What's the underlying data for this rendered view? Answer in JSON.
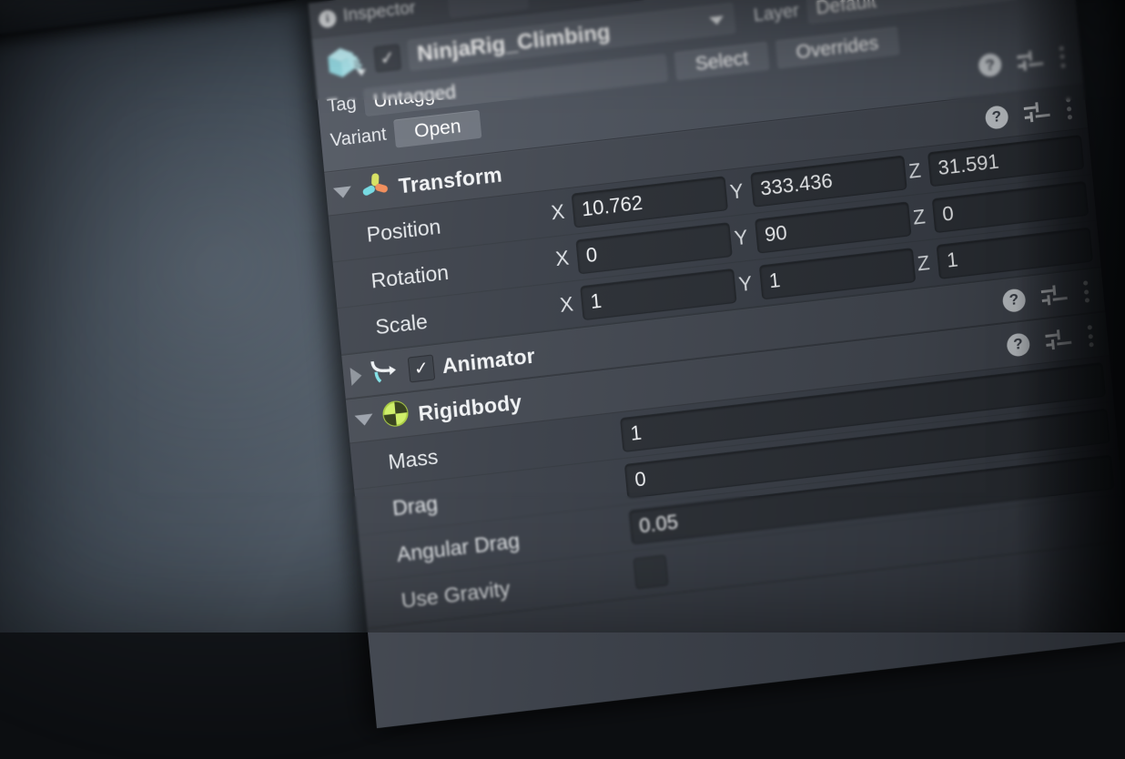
{
  "window": {
    "tab_label": "Inspector",
    "info_icon": "info-icon"
  },
  "object_header": {
    "enabled_checkbox": "checked",
    "name": "NinjaRig_Climbing",
    "name_dropdown_icon": "chevron-down-icon",
    "prefab_icon": "prefab-variant-cube-icon",
    "tag_label": "Tag",
    "tag_value": "Untagged",
    "layer_label": "Layer",
    "layer_value": "Default",
    "static_overrides_label": "Overrides",
    "select_button": "Select",
    "open_button": "Open",
    "variant_label": "Variant"
  },
  "components": [
    {
      "name": "Transform",
      "icon": "transform-gizmo-icon",
      "expanded": true,
      "enabled": null,
      "help_icon": "help-icon",
      "preset_icon": "preset-sliders-icon",
      "menu_icon": "kebab-menu-icon",
      "rows": [
        {
          "label": "Position",
          "x": "10.762",
          "y": "333.436",
          "z": "31.591"
        },
        {
          "label": "Rotation",
          "x": "0",
          "y": "90",
          "z": "0"
        },
        {
          "label": "Scale",
          "x": "1",
          "y": "1",
          "z": "1"
        }
      ]
    },
    {
      "name": "Animator",
      "icon": "animator-icon",
      "expanded": false,
      "enabled": "checked",
      "help_icon": "help-icon",
      "preset_icon": "preset-sliders-icon",
      "menu_icon": "kebab-menu-icon",
      "rows": []
    },
    {
      "name": "Rigidbody",
      "icon": "rigidbody-icon",
      "expanded": true,
      "enabled": null,
      "help_icon": "help-icon",
      "preset_icon": "preset-sliders-icon",
      "menu_icon": "kebab-menu-icon",
      "rows": [
        {
          "label": "Mass",
          "value": "1"
        },
        {
          "label": "Drag",
          "value": "0"
        },
        {
          "label": "Angular Drag",
          "value": "0.05"
        },
        {
          "label": "Use Gravity",
          "value": ""
        }
      ]
    }
  ],
  "axis_labels": {
    "x": "X",
    "y": "Y",
    "z": "Z"
  },
  "colors": {
    "panel_bg": "#3b4049",
    "header_bg": "#4d535d",
    "field_bg": "#2c3036",
    "text": "#e9ecef",
    "prefab_cyan": "#a9e8ee",
    "rigidbody_green": "#c3e85a",
    "axis_x": "#f07e4a",
    "axis_y": "#d4e157",
    "axis_z": "#6fd8e0"
  }
}
